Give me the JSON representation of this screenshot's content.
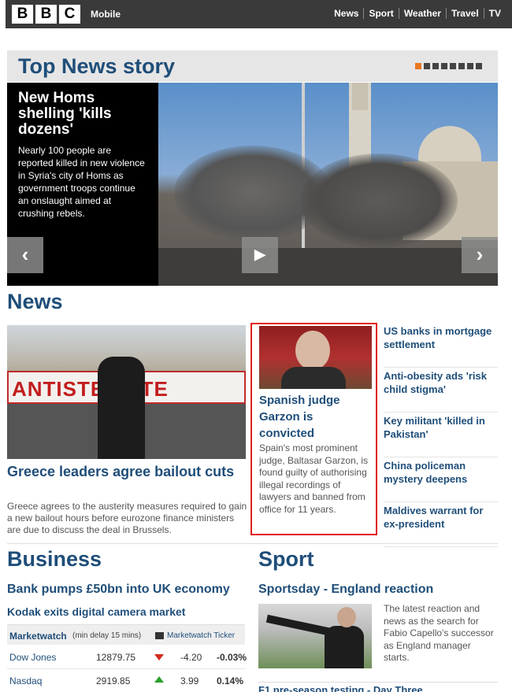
{
  "header": {
    "logo_letters": [
      "B",
      "B",
      "C"
    ],
    "mobile_label": "Mobile",
    "nav": [
      "News",
      "Sport",
      "Weather",
      "Travel",
      "TV"
    ]
  },
  "top_story": {
    "section_title": "Top News story",
    "pager_count": 8,
    "pager_active_index": 0,
    "headline": "New Homs shelling 'kills dozens'",
    "summary": "Nearly 100 people are reported killed in new violence in Syria's city of Homs as government troops continue an onslaught aimed at crushing rebels.",
    "prev_icon": "‹",
    "play_icon": "▶",
    "next_icon": "›"
  },
  "news": {
    "section_title": "News",
    "lead": {
      "banner_text": "ANTISTE ASTE",
      "headline": "Greece leaders agree bailout cuts",
      "summary": "Greece agrees to the austerity measures required to gain a new bailout hours before eurozone finance ministers are due to discuss the deal in Brussels."
    },
    "feature": {
      "headline": "Spanish judge Garzon is convicted",
      "summary": "Spain's most prominent judge, Baltasar Garzon, is found guilty of authorising illegal recordings of lawyers and banned from office for 11 years."
    },
    "side_links": [
      "US banks in mortgage settlement",
      "Anti-obesity ads 'risk child stigma'",
      "Key militant 'killed in Pakistan'",
      "China policeman mystery deepens",
      "Maldives warrant for ex-president"
    ]
  },
  "business": {
    "section_title": "Business",
    "link1": "Bank pumps £50bn into UK economy",
    "link2": "Kodak exits digital camera market",
    "marketwatch": {
      "title": "Marketwatch",
      "note": "(min delay 15 mins)",
      "ticker_label": "Marketwatch Ticker",
      "rows": [
        {
          "name": "Dow Jones",
          "value": "12879.75",
          "direction": "down",
          "change": "-4.20",
          "pct": "-0.03%"
        },
        {
          "name": "Nasdaq",
          "value": "2919.85",
          "direction": "up",
          "change": "3.99",
          "pct": "0.14%"
        }
      ]
    }
  },
  "sport": {
    "section_title": "Sport",
    "link1": "Sportsday - England reaction",
    "summary": "The latest reaction and news as the search for Fabio Capello's successor as England manager starts.",
    "link2": "F1 pre-season testing - Day Three"
  },
  "colors": {
    "brand_blue": "#1f4e79",
    "topbar": "#3a3a3a",
    "pager_active": "#e87722",
    "feature_border": "#e0201c",
    "down": "#d12a1f",
    "up": "#2ca02c"
  }
}
